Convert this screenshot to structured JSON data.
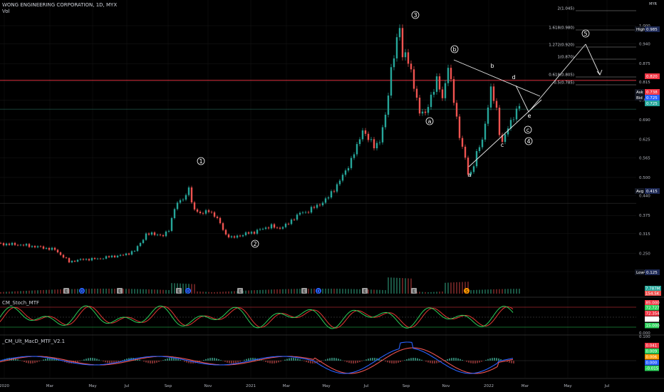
{
  "header": {
    "title": "WONG ENGINEERING CORPORATION, 1D, MYX",
    "volume_label": "Vol",
    "currency": "MYR"
  },
  "chart_data": {
    "type": "candlestick",
    "symbol": "WONG ENGINEERING CORPORATION",
    "interval": "1D",
    "exchange": "MYX",
    "price_axis": {
      "ticks": [
        1.0,
        0.94,
        0.875,
        0.815,
        0.755,
        0.69,
        0.625,
        0.565,
        0.5,
        0.44,
        0.375,
        0.315,
        0.25,
        0.19
      ],
      "tick_labels": [
        "1.000",
        "0.940",
        "0.875",
        "0.815",
        "0.755",
        "0.690",
        "0.625",
        "0.565",
        "0.500",
        "0.440",
        "0.375",
        "0.315",
        "0.250",
        "0.190"
      ]
    },
    "time_axis": {
      "labels": [
        "2020",
        "Mar",
        "May",
        "Jul",
        "Sep",
        "Nov",
        "2021",
        "Mar",
        "May",
        "Jul",
        "Sep",
        "Nov",
        "2022",
        "Mar",
        "May",
        "Jul"
      ]
    },
    "price_path": [
      [
        0,
        0.282
      ],
      [
        8,
        0.278
      ],
      [
        15,
        0.27
      ],
      [
        20,
        0.262
      ],
      [
        23,
        0.238
      ],
      [
        25,
        0.222
      ],
      [
        27,
        0.226
      ],
      [
        30,
        0.23
      ],
      [
        35,
        0.232
      ],
      [
        40,
        0.24
      ],
      [
        44,
        0.244
      ],
      [
        48,
        0.258
      ],
      [
        52,
        0.312
      ],
      [
        55,
        0.315
      ],
      [
        58,
        0.306
      ],
      [
        60,
        0.33
      ],
      [
        62,
        0.398
      ],
      [
        64,
        0.425
      ],
      [
        66,
        0.44
      ],
      [
        67,
        0.47
      ],
      [
        68,
        0.41
      ],
      [
        70,
        0.388
      ],
      [
        72,
        0.38
      ],
      [
        74,
        0.392
      ],
      [
        76,
        0.375
      ],
      [
        78,
        0.348
      ],
      [
        80,
        0.312
      ],
      [
        82,
        0.3
      ],
      [
        84,
        0.308
      ],
      [
        86,
        0.31
      ],
      [
        88,
        0.318
      ],
      [
        90,
        0.32
      ],
      [
        92,
        0.328
      ],
      [
        94,
        0.335
      ],
      [
        96,
        0.34
      ],
      [
        98,
        0.332
      ],
      [
        100,
        0.338
      ],
      [
        102,
        0.348
      ],
      [
        104,
        0.368
      ],
      [
        106,
        0.382
      ],
      [
        108,
        0.385
      ],
      [
        110,
        0.398
      ],
      [
        112,
        0.405
      ],
      [
        114,
        0.42
      ],
      [
        116,
        0.435
      ],
      [
        118,
        0.462
      ],
      [
        120,
        0.49
      ],
      [
        122,
        0.52
      ],
      [
        124,
        0.56
      ],
      [
        126,
        0.6
      ],
      [
        128,
        0.66
      ],
      [
        130,
        0.625
      ],
      [
        132,
        0.605
      ],
      [
        134,
        0.62
      ],
      [
        136,
        0.7
      ],
      [
        138,
        0.86
      ],
      [
        140,
        0.945
      ],
      [
        141,
        0.995
      ],
      [
        142,
        0.9
      ],
      [
        143,
        0.915
      ],
      [
        144,
        0.88
      ],
      [
        146,
        0.8
      ],
      [
        148,
        0.72
      ],
      [
        150,
        0.705
      ],
      [
        152,
        0.77
      ],
      [
        154,
        0.82
      ],
      [
        156,
        0.76
      ],
      [
        158,
        0.87
      ],
      [
        160,
        0.75
      ],
      [
        162,
        0.64
      ],
      [
        164,
        0.56
      ],
      [
        165,
        0.51
      ],
      [
        166,
        0.515
      ],
      [
        168,
        0.58
      ],
      [
        170,
        0.62
      ],
      [
        172,
        0.74
      ],
      [
        173,
        0.79
      ],
      [
        175,
        0.72
      ],
      [
        176,
        0.65
      ],
      [
        177,
        0.618
      ],
      [
        179,
        0.66
      ],
      [
        181,
        0.705
      ],
      [
        183,
        0.738
      ]
    ],
    "last_price": 0.738,
    "waves": {
      "impulse": [
        "1",
        "2",
        "3",
        "4",
        "5"
      ],
      "correction": [
        "a",
        "b",
        "c",
        "d",
        "e"
      ],
      "corr_circled": [
        "a",
        "b",
        "c"
      ]
    },
    "fibonacci": [
      {
        "ratio": "2",
        "price": "1.045",
        "label": "2(1.045)"
      },
      {
        "ratio": "1.618",
        "price": "0.980",
        "label": "1.618(0.980)"
      },
      {
        "ratio": "1.272",
        "price": "0.920",
        "label": "1.272(0.920)"
      },
      {
        "ratio": "1",
        "price": "0.870",
        "label": "1(0.870)"
      },
      {
        "ratio": "0.618",
        "price": "0.805",
        "label": "0.618(0.805)"
      },
      {
        "ratio": "0.5",
        "price": "0.785",
        "label": "0.5(0.785)"
      }
    ],
    "price_tags": [
      {
        "name": "High",
        "value": "0.985",
        "color": "#1e2a56"
      },
      {
        "name": "",
        "value": "0.820",
        "color": "#f23645"
      },
      {
        "name": "Ask",
        "value": "0.738",
        "color": "#f23645"
      },
      {
        "name": "Bid",
        "value": "0.725",
        "color": "#2962ff"
      },
      {
        "name": "",
        "value": "0.725",
        "color": "#26a69a"
      },
      {
        "name": "Avg",
        "value": "0.415",
        "color": "#1e2a56"
      },
      {
        "name": "Low",
        "value": "0.125",
        "color": "#1e2a56"
      }
    ],
    "horizontal_lines": [
      0.82,
      0.725,
      0.415
    ],
    "volume_tags": [
      "7.787M",
      "154.5K"
    ],
    "events": [
      "E",
      "D",
      "E",
      "E",
      "D",
      "E",
      "E",
      "D",
      "E",
      "E",
      "S"
    ],
    "stochastic": {
      "title": "CM_Stoch_MTF",
      "levels": [
        "85.000",
        "72.727",
        "72.354",
        "50.000",
        "15.000",
        "0.000"
      ]
    },
    "macd": {
      "title": "_CM_Ult_MacD_MTF_V2.1",
      "values": [
        "0.041",
        "0.009",
        "0.006",
        "0.000",
        "-0.015"
      ],
      "axis_top": "0.100"
    },
    "colors": {
      "up": "#26a69a",
      "down": "#ef5350",
      "resistance_line": "#f23645",
      "support_line": "#2e7d6b",
      "stoch_k": "#2bd15a",
      "stoch_d": "#e53935",
      "macd": "#2962ff",
      "signal": "#ef5350"
    }
  }
}
